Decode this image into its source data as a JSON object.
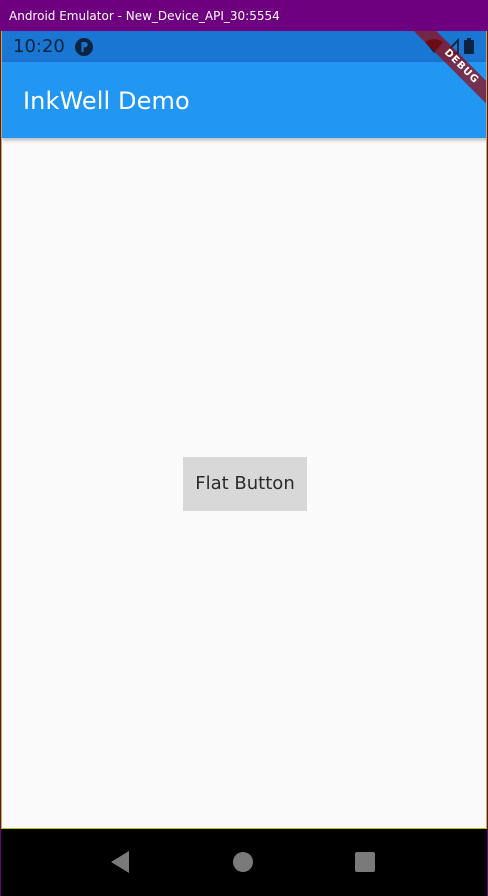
{
  "window": {
    "title": "Android Emulator - New_Device_API_30:5554"
  },
  "status_bar": {
    "time": "10:20",
    "icons": [
      "app-notification-icon",
      "wifi-icon",
      "signal-icon",
      "battery-icon"
    ]
  },
  "app_bar": {
    "title": "InkWell Demo"
  },
  "debug_banner": {
    "label": "DEBUG"
  },
  "body": {
    "button_label": "Flat Button"
  },
  "nav_bar": {
    "items": [
      "back-icon",
      "home-icon",
      "recents-icon"
    ]
  },
  "colors": {
    "window_titlebar": "#6e0080",
    "status_bar": "#1976d2",
    "app_bar": "#2196f3",
    "background": "#fafafa",
    "button": "#d8d8d8",
    "debug_banner": "#a00000",
    "nav_bar": "#000000"
  }
}
